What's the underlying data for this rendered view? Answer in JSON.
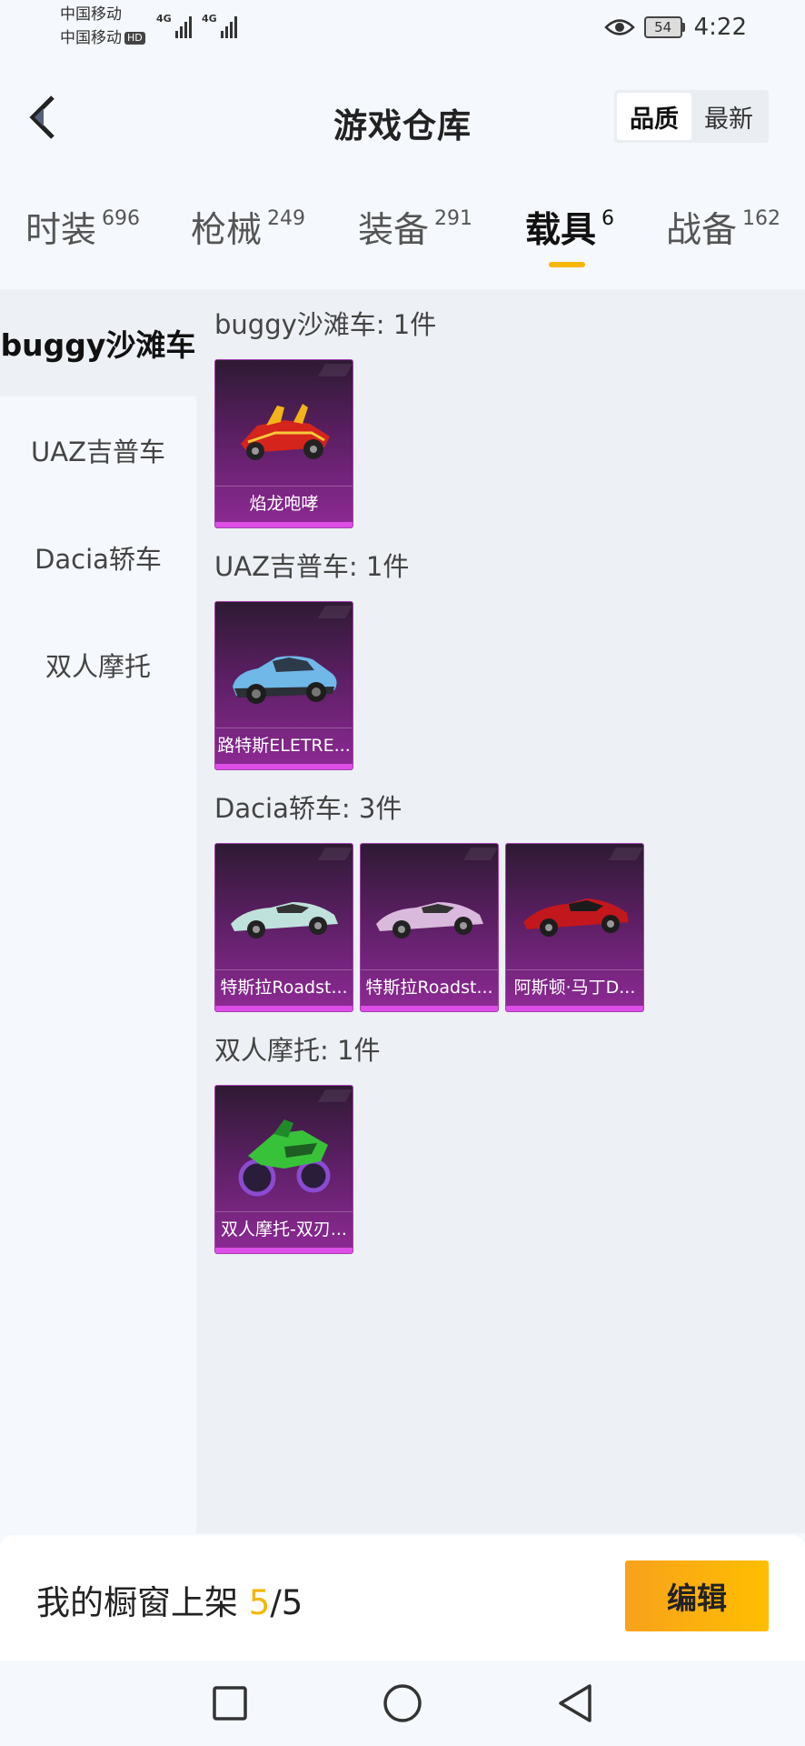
{
  "status_bar": {
    "carrier1": "中国移动",
    "carrier2": "中国移动",
    "hd_badge": "HD",
    "network1": "4G",
    "network2": "4G",
    "battery": "54",
    "time": "4:22"
  },
  "header": {
    "title": "游戏仓库",
    "sort_options": [
      "品质",
      "最新"
    ],
    "sort_active": "品质"
  },
  "tabs": [
    {
      "label": "时装",
      "count": "696"
    },
    {
      "label": "枪械",
      "count": "249"
    },
    {
      "label": "装备",
      "count": "291"
    },
    {
      "label": "载具",
      "count": "6"
    },
    {
      "label": "战备",
      "count": "162"
    }
  ],
  "active_tab": "载具",
  "sidebar": {
    "items": [
      "buggy沙滩车",
      "UAZ吉普车",
      "Dacia轿车",
      "双人摩托"
    ],
    "active": "buggy沙滩车"
  },
  "groups": [
    {
      "title": "buggy沙滩车: 1件",
      "items": [
        {
          "name": "焰龙咆哮",
          "icon": "red-buggy-icon"
        }
      ]
    },
    {
      "title": "UAZ吉普车: 1件",
      "items": [
        {
          "name": "路特斯ELETRE...",
          "icon": "blue-suv-icon"
        }
      ]
    },
    {
      "title": "Dacia轿车: 3件",
      "items": [
        {
          "name": "特斯拉Roadst...",
          "icon": "mint-roadster-icon"
        },
        {
          "name": "特斯拉Roadst...",
          "icon": "lilac-roadster-icon"
        },
        {
          "name": "阿斯顿·马丁D...",
          "icon": "red-sportscar-icon"
        }
      ]
    },
    {
      "title": "双人摩托: 1件",
      "items": [
        {
          "name": "双人摩托-双刃...",
          "icon": "green-motorcycle-icon"
        }
      ]
    }
  ],
  "bottom": {
    "showcase_label": "我的橱窗上架 ",
    "showcase_current": "5",
    "showcase_total": "/5",
    "edit_label": "编辑"
  },
  "colors": {
    "accent": "#f5b700",
    "card_purple": "#8e2a96",
    "card_border": "#dd4ee6"
  }
}
